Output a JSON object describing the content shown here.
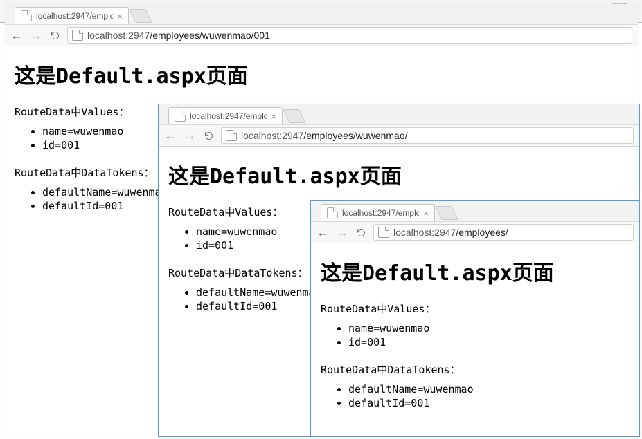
{
  "global": {
    "tab_title": "localhost:2947/employe",
    "tab_close": "×"
  },
  "windows": [
    {
      "id": "win1",
      "url_host": "localhost",
      "url_port": ":2947",
      "url_path": "/employees/wuwenmao/001"
    },
    {
      "id": "win2",
      "url_host": "localhost",
      "url_port": ":2947",
      "url_path": "/employees/wuwenmao/"
    },
    {
      "id": "win3",
      "url_host": "localhost",
      "url_port": ":2947",
      "url_path": "/employees/"
    }
  ],
  "page": {
    "heading": "这是Default.aspx页面",
    "section_values": "RouteData中Values：",
    "values_items": [
      "name=wuwenmao",
      "id=001"
    ],
    "section_tokens": "RouteData中DataTokens：",
    "tokens_items": [
      "defaultName=wuwenmao",
      "defaultId=001"
    ]
  }
}
